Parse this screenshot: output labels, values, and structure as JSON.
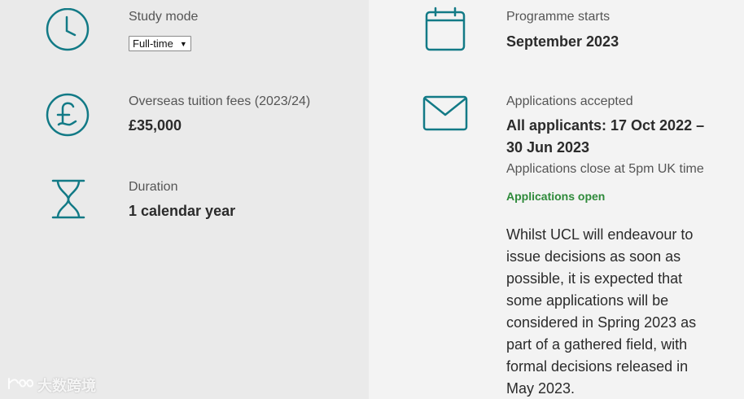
{
  "study_mode": {
    "label": "Study mode",
    "selected": "Full-time"
  },
  "fees": {
    "label": "Overseas tuition fees (2023/24)",
    "value": "£35,000"
  },
  "duration": {
    "label": "Duration",
    "value": "1 calendar year"
  },
  "programme": {
    "label": "Programme starts",
    "value": "September 2023"
  },
  "applications": {
    "label": "Applications accepted",
    "value_line1": "All applicants: 17 Oct 2022 –",
    "value_line2": "30 Jun 2023",
    "note": "Applications close at 5pm UK time",
    "status": "Applications open",
    "paragraph_lines": [
      "Whilst UCL will endeavour to",
      "issue decisions as soon as",
      "possible, it is expected that",
      "some applications will be",
      "considered in Spring 2023 as",
      "part of a gathered field, with",
      "formal decisions released in",
      "May 2023."
    ]
  },
  "watermark": {
    "text": "大数跨境"
  },
  "colors": {
    "icon": "#127a86",
    "status": "#2e8a3a"
  },
  "icons": [
    "clock-icon",
    "pound-icon",
    "hourglass-icon",
    "calendar-icon",
    "envelope-icon"
  ]
}
